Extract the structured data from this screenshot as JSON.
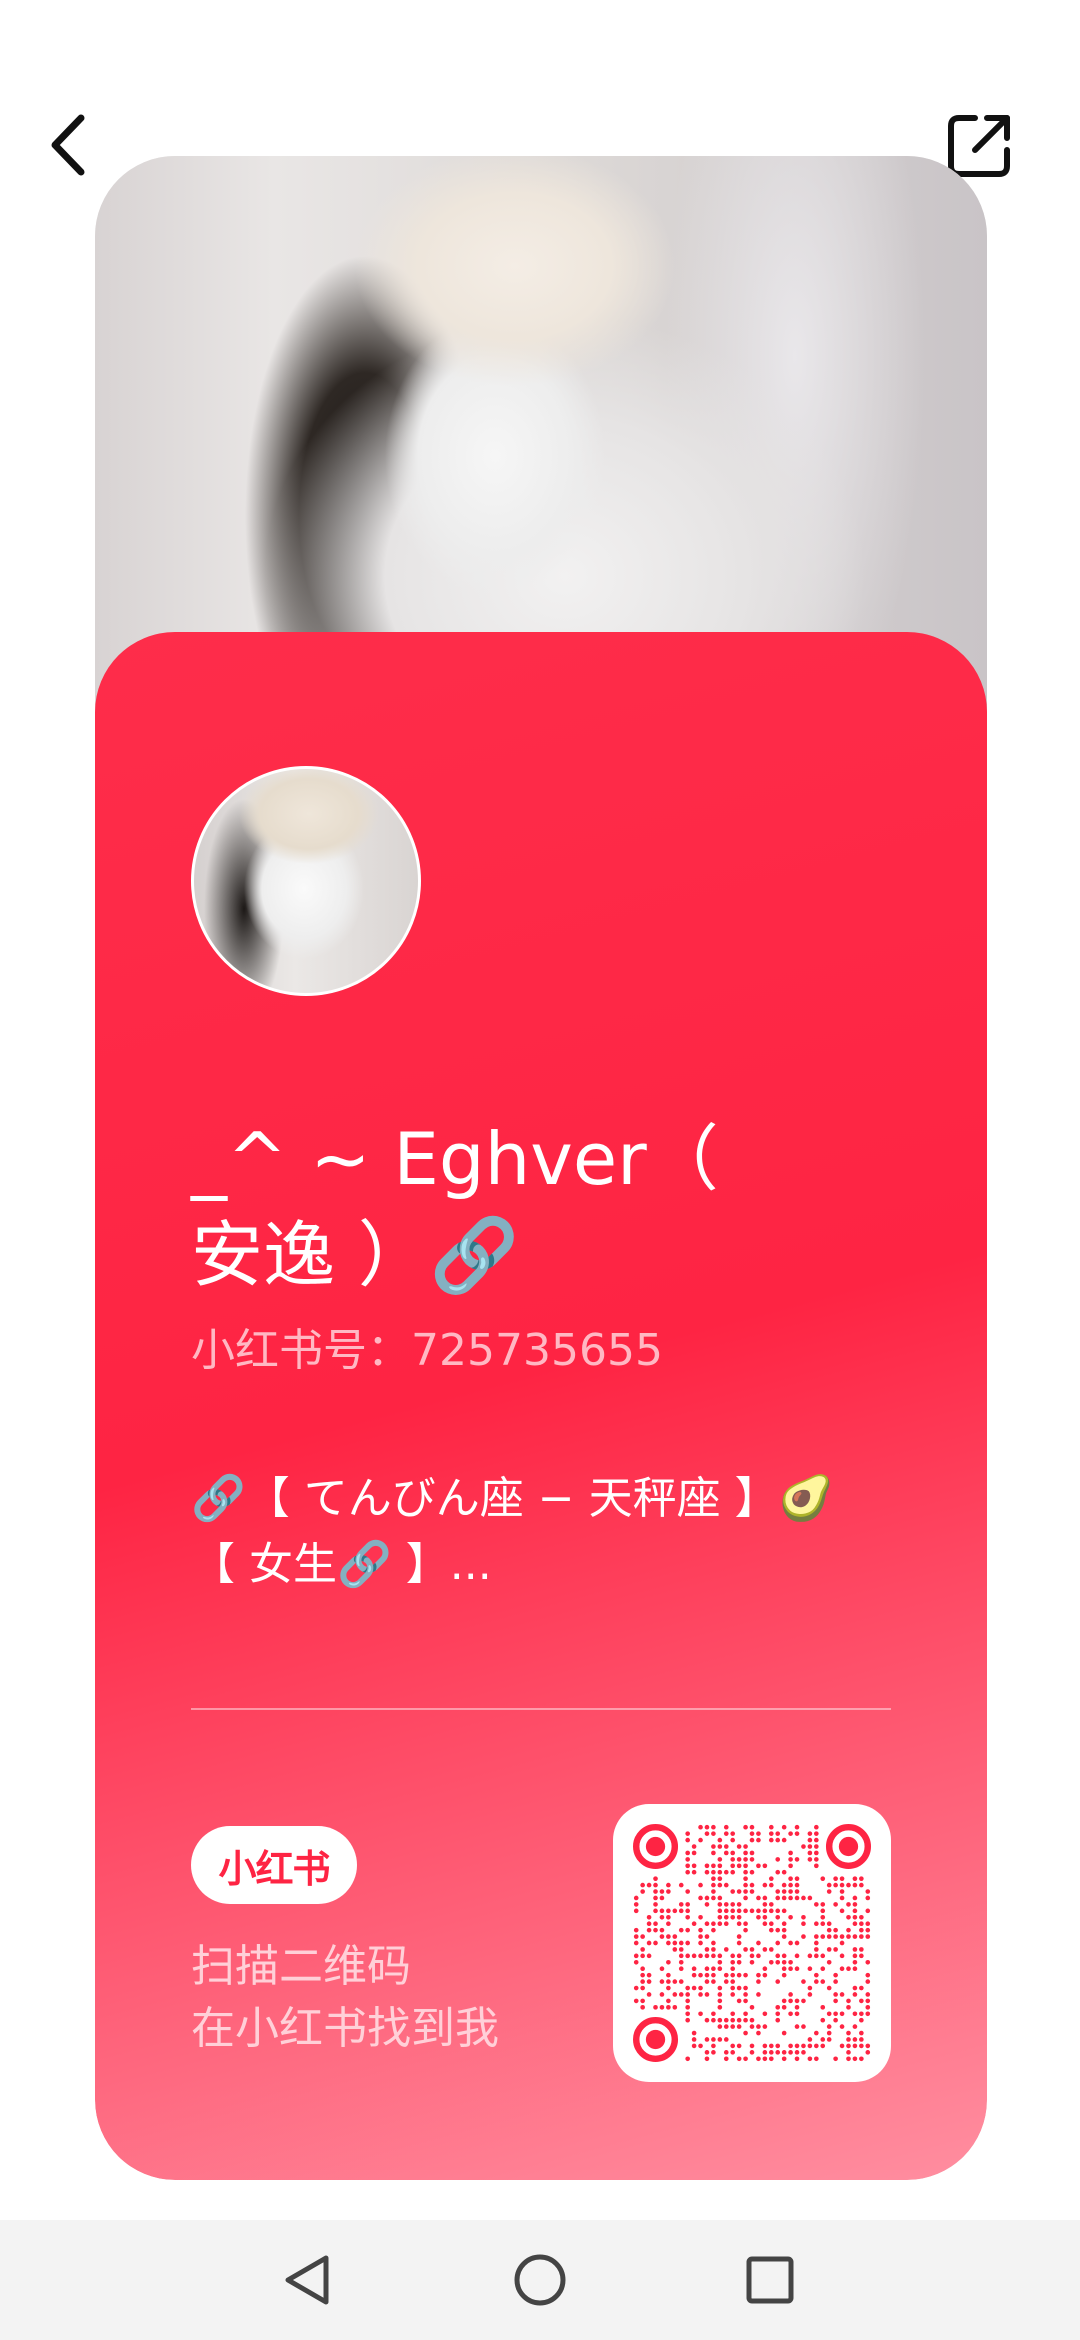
{
  "profile": {
    "name": "_^ ~ Eghver（ 安逸 ）🔗",
    "red_id": "小红书号：725735655",
    "bio": "🔗【 てんびん座 − 天秤座 】🥑【 女生🔗 】..."
  },
  "footer": {
    "logo_text": "小红书",
    "scan_line1": "扫描二维码",
    "scan_line2": "在小红书找到我"
  },
  "colors": {
    "brand_red": "#fe2443",
    "panel_gradient_end": "#ff8ea0"
  },
  "icons": {
    "back": "chevron-left-icon",
    "share": "share-external-icon",
    "nav_back": "triangle-back-icon",
    "nav_home": "circle-home-icon",
    "nav_recents": "square-recents-icon"
  }
}
